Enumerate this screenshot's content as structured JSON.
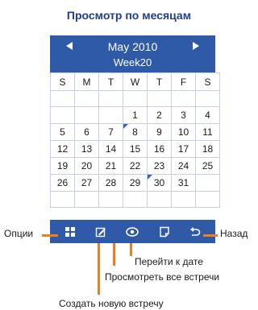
{
  "title": "Просмотр по месяцам",
  "header": {
    "month": "May 2010",
    "week": "Week20"
  },
  "weekdays": [
    "S",
    "M",
    "T",
    "W",
    "T",
    "F",
    "S"
  ],
  "weeks": [
    [
      "",
      "",
      "",
      "",
      "",
      "",
      ""
    ],
    [
      "",
      "",
      "",
      "",
      "1",
      "2",
      "3",
      "4"
    ],
    [
      "5",
      "6",
      "7",
      "8",
      "9",
      "10",
      "11"
    ],
    [
      "12",
      "13",
      "14",
      "15",
      "16",
      "17",
      "18"
    ],
    [
      "19",
      "20",
      "21",
      "22",
      "23",
      "24",
      "25"
    ],
    [
      "26",
      "27",
      "28",
      "29",
      "30",
      "31",
      ""
    ],
    [
      "",
      "",
      "",
      "",
      "",
      "",
      ""
    ]
  ],
  "labels": {
    "options": "Опции",
    "back": "Назад",
    "goto_date": "Перейти к дате",
    "view_all": "Просмотреть все встречи",
    "create_new": "Создать новую встречу"
  },
  "colors": {
    "accent": "#2f5aa8",
    "callout": "#f47b20",
    "title": "#1f3f8c"
  }
}
